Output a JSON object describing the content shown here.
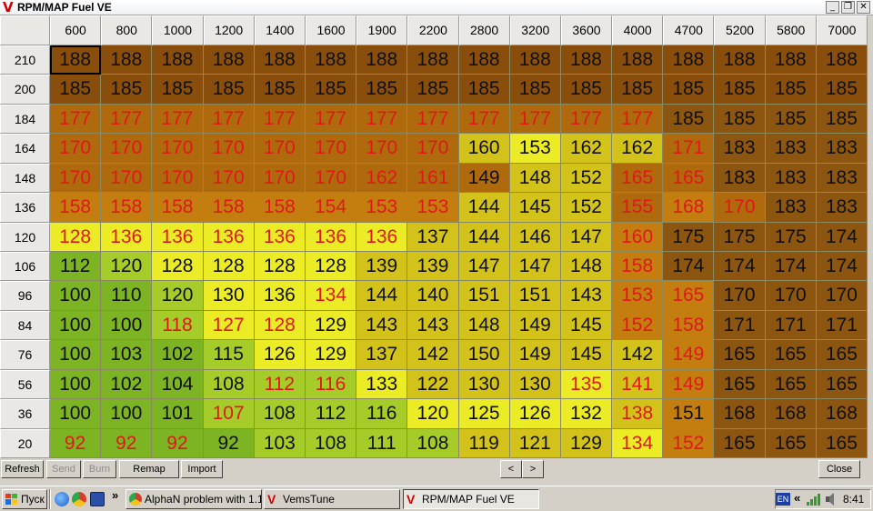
{
  "window": {
    "title": "RPM/MAP Fuel VE",
    "controls": [
      "_",
      "❐",
      "✕"
    ]
  },
  "table": {
    "rpm": [
      "600",
      "800",
      "1000",
      "1200",
      "1400",
      "1600",
      "1900",
      "2200",
      "2800",
      "3200",
      "3600",
      "4000",
      "4700",
      "5200",
      "5800",
      "7000"
    ],
    "map": [
      "210",
      "200",
      "184",
      "164",
      "148",
      "136",
      "120",
      "106",
      "96",
      "84",
      "76",
      "56",
      "36",
      "20"
    ],
    "values": [
      [
        188,
        188,
        188,
        188,
        188,
        188,
        188,
        188,
        188,
        188,
        188,
        188,
        188,
        188,
        188,
        188
      ],
      [
        185,
        185,
        185,
        185,
        185,
        185,
        185,
        185,
        185,
        185,
        185,
        185,
        185,
        185,
        185,
        185
      ],
      [
        177,
        177,
        177,
        177,
        177,
        177,
        177,
        177,
        177,
        177,
        177,
        177,
        185,
        185,
        185,
        185
      ],
      [
        170,
        170,
        170,
        170,
        170,
        170,
        170,
        170,
        160,
        153,
        162,
        162,
        171,
        183,
        183,
        183
      ],
      [
        170,
        170,
        170,
        170,
        170,
        170,
        162,
        161,
        149,
        148,
        152,
        165,
        165,
        183,
        183,
        183
      ],
      [
        158,
        158,
        158,
        158,
        158,
        154,
        153,
        153,
        144,
        145,
        152,
        155,
        168,
        170,
        183,
        183
      ],
      [
        128,
        136,
        136,
        136,
        136,
        136,
        136,
        137,
        144,
        146,
        147,
        160,
        175,
        175,
        175,
        174
      ],
      [
        112,
        120,
        128,
        128,
        128,
        128,
        139,
        139,
        147,
        147,
        148,
        158,
        174,
        174,
        174,
        174
      ],
      [
        100,
        110,
        120,
        130,
        136,
        134,
        144,
        140,
        151,
        151,
        143,
        153,
        165,
        170,
        170,
        170
      ],
      [
        100,
        100,
        118,
        127,
        128,
        129,
        143,
        143,
        148,
        149,
        145,
        152,
        158,
        171,
        171,
        171
      ],
      [
        100,
        103,
        102,
        115,
        126,
        129,
        137,
        142,
        150,
        149,
        145,
        142,
        149,
        165,
        165,
        165
      ],
      [
        100,
        102,
        104,
        108,
        112,
        116,
        133,
        122,
        130,
        130,
        135,
        141,
        149,
        165,
        165,
        165
      ],
      [
        100,
        100,
        101,
        107,
        108,
        112,
        116,
        120,
        125,
        126,
        132,
        138,
        151,
        168,
        168,
        168
      ],
      [
        92,
        92,
        92,
        92,
        103,
        108,
        111,
        108,
        119,
        121,
        129,
        134,
        152,
        165,
        165,
        165
      ]
    ],
    "text_colors": [
      "kkkkkkkkkkkkkkkk",
      "kkkkkkkkkkkkkkkk",
      "rrrrrrrrrrrrkkkk",
      "rrrrrrrrkkkkrkkk",
      "rrrrrrrrkkkrrkkk",
      "rrrrrrrrkkkrrrkk",
      "rrrrrrrkkkkrkkkk",
      "kkkkkkkkkkkrkkkk",
      "kkkkkrkkkkkrrkkk",
      "kkrrrkkkkkkrrkkk",
      "kkkkkkkkkkkkrkkk",
      "kkkkrrkkkkrrrkkk",
      "kkkrkkkkkkkrkkkk",
      "rrrkkkkkkkkrrkkk"
    ],
    "cell_colors": [
      "bbbbbbbbbbbbbbbb",
      "bbbbbbbbbbbbbbbb",
      "ooooooooooooBBBB",
      "ooooooooyYyyoBBB",
      "oooooooooyyooBBB",
      "OOOOOOOOyyyoOoBB",
      "YYYYYYYyyyyOBBBB",
      "GgYYYYyyyyyOBBBB",
      "GGgYYYyyyyyOOBBB",
      "GGgYYYyyyyyOOBBB",
      "GGGgYYyyyyyyOBBB",
      "GGGgggYyyyYyOBBB",
      "GGGggggYYYYyOBBB",
      "GGGGggggyyyYOBBB"
    ],
    "palette": {
      "b": "#8a4e0c",
      "B": "#8c5510",
      "o": "#b06a0e",
      "O": "#c47e10",
      "y": "#d2c21a",
      "Y": "#ecec26",
      "g": "#a6cc2a",
      "G": "#7cb424",
      "red": "#e01818",
      "black": "#101010"
    },
    "selected": [
      0,
      0
    ]
  },
  "toolbar": {
    "refresh": "Refresh",
    "send": "Send",
    "burn": "Burn",
    "remap": "Remap",
    "import": "Import",
    "prev": "<",
    "next": ">",
    "close": "Close"
  },
  "taskbar": {
    "start": "Пуск",
    "chevron": "»",
    "tasks": [
      {
        "label": "AlphaN problem with 1.1...",
        "active": false
      },
      {
        "label": "VemsTune",
        "active": false
      },
      {
        "label": "RPM/MAP Fuel VE",
        "active": true
      }
    ],
    "lang": "EN",
    "tray_chevron": "«",
    "clock": "8:41"
  }
}
